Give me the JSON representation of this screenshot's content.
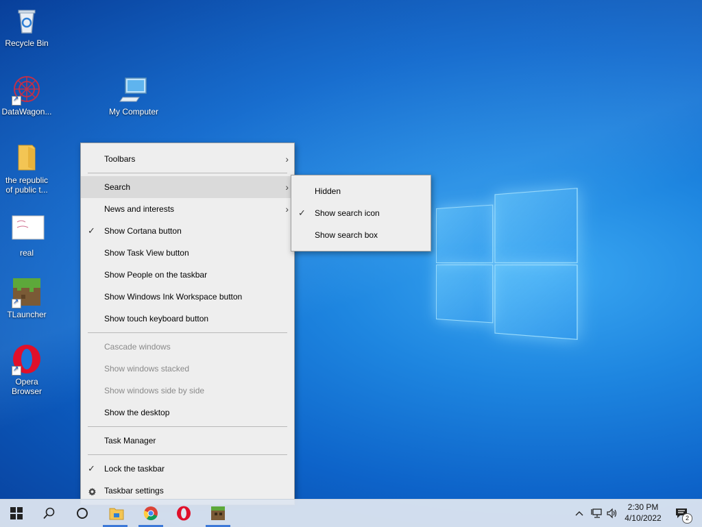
{
  "desktop": {
    "icons": [
      {
        "label": "Recycle Bin",
        "icon": "recycle-bin-icon"
      },
      {
        "label": "DataWagon...",
        "icon": "datawagon-icon"
      },
      {
        "label": "My Computer",
        "icon": "computer-icon"
      },
      {
        "label": "the republic of public t...",
        "label_line1": "the republic",
        "label_line2": "of public t...",
        "icon": "folder-icon"
      },
      {
        "label": "real",
        "icon": "image-file-icon"
      },
      {
        "label": "TLauncher",
        "icon": "tlauncher-icon"
      },
      {
        "label": "Opera Browser",
        "label_line1": "Opera",
        "label_line2": "Browser",
        "icon": "opera-icon"
      }
    ]
  },
  "context_menu": {
    "items": [
      {
        "label": "Toolbars",
        "submenu": true
      },
      {
        "label": "Search",
        "submenu": true,
        "highlighted": true
      },
      {
        "label": "News and interests",
        "submenu": true
      },
      {
        "label": "Show Cortana button",
        "checked": true
      },
      {
        "label": "Show Task View button"
      },
      {
        "label": "Show People on the taskbar"
      },
      {
        "label": "Show Windows Ink Workspace button"
      },
      {
        "label": "Show touch keyboard button"
      },
      {
        "label": "Cascade windows",
        "disabled": true
      },
      {
        "label": "Show windows stacked",
        "disabled": true
      },
      {
        "label": "Show windows side by side",
        "disabled": true
      },
      {
        "label": "Show the desktop"
      },
      {
        "label": "Task Manager"
      },
      {
        "label": "Lock the taskbar",
        "checked": true
      },
      {
        "label": "Taskbar settings",
        "icon": "gear-icon"
      }
    ]
  },
  "search_submenu": {
    "items": [
      {
        "label": "Hidden"
      },
      {
        "label": "Show search icon",
        "checked": true
      },
      {
        "label": "Show search box"
      }
    ]
  },
  "taskbar": {
    "start_icon": "windows-start-icon",
    "search_icon": "search-icon",
    "cortana_icon": "cortana-icon",
    "pinned": [
      "file-explorer-icon",
      "chrome-icon",
      "opera-icon",
      "minecraft-icon"
    ],
    "tray": {
      "time": "2:30 PM",
      "date": "4/10/2022",
      "notification_count": "2"
    }
  },
  "glyphs": {
    "check": "✓",
    "arrow": "›",
    "chevron_up": "^",
    "speaker": "🔊"
  }
}
